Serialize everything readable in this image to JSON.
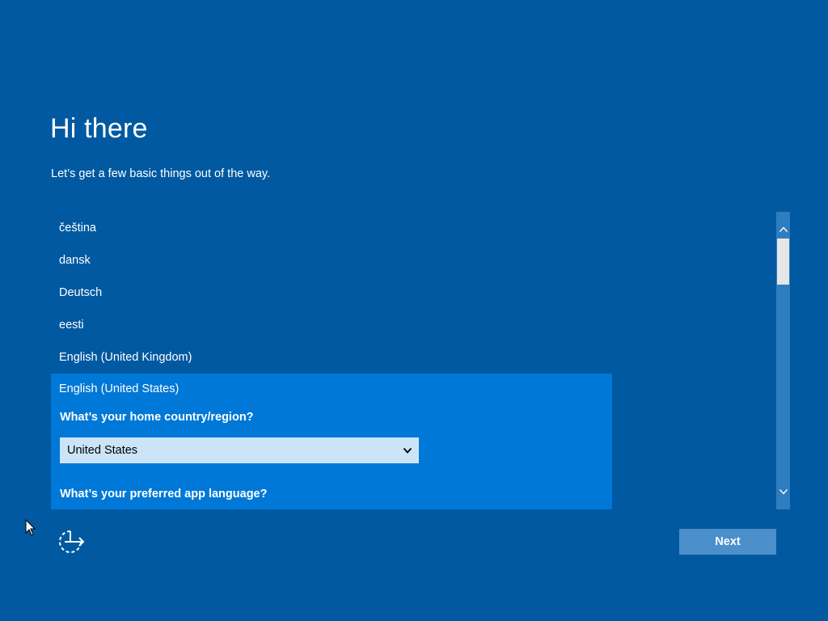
{
  "header": {
    "title": "Hi there",
    "subtitle": "Let’s get a few basic things out of the way."
  },
  "languages": {
    "items": [
      {
        "label": "čeština"
      },
      {
        "label": "dansk"
      },
      {
        "label": "Deutsch"
      },
      {
        "label": "eesti"
      },
      {
        "label": "English (United Kingdom)"
      }
    ],
    "selected": {
      "label": "English (United States)",
      "country_question": "What’s your home country/region?",
      "country_value": "United States",
      "app_language_question": "What’s your preferred app language?"
    }
  },
  "footer": {
    "next_label": "Next"
  },
  "icons": {
    "ease_of_access": "ease-of-access-icon",
    "dropdown": "chevron-down-icon",
    "scroll_up": "chevron-up-icon",
    "scroll_down": "chevron-down-icon"
  },
  "colors": {
    "background": "#0059a1",
    "selected_item": "#0078d7",
    "dropdown_bg": "#cce4f7",
    "next_button": "#4b8fcb",
    "scrollbar_track": "#2f7dc1"
  }
}
